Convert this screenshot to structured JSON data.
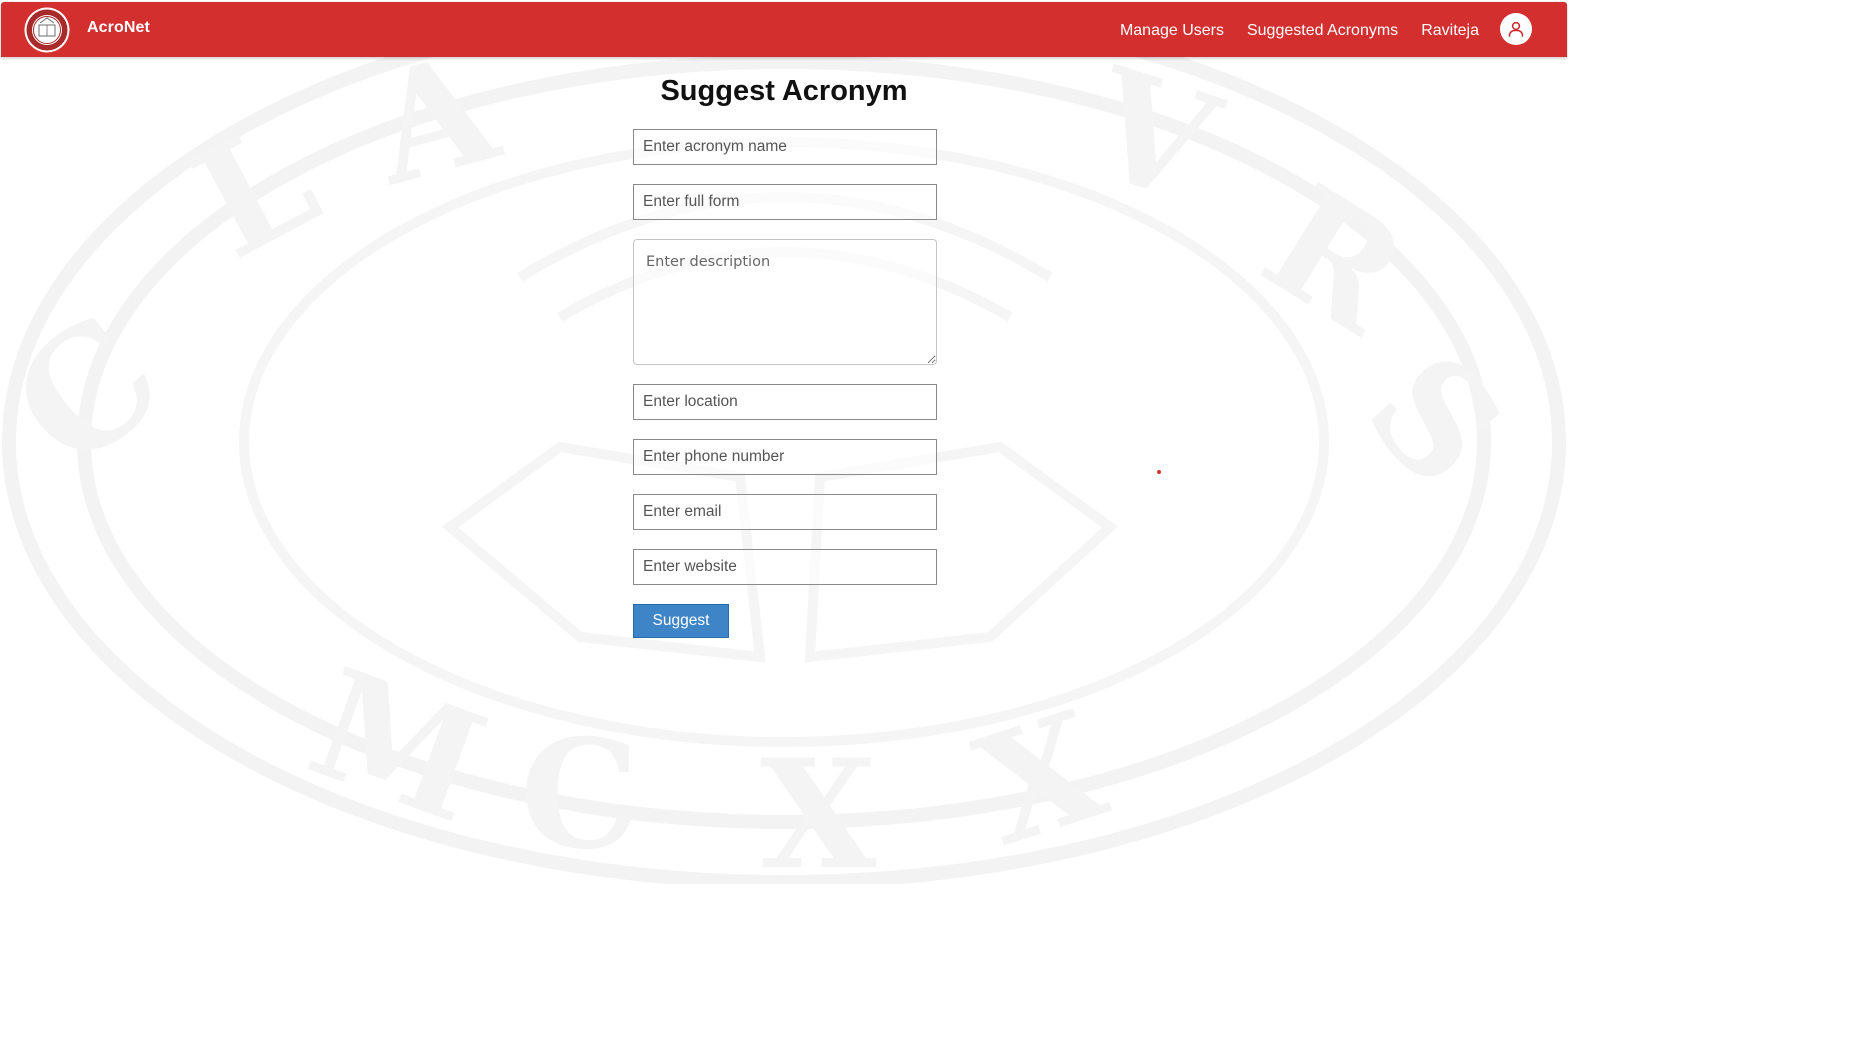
{
  "app": {
    "brand": "AcroNet",
    "brand_color": "#d32f2f",
    "logo_icon": "university-seal-icon"
  },
  "nav": {
    "items": [
      {
        "label": "Manage Users"
      },
      {
        "label": "Suggested Acronyms"
      },
      {
        "label": "Raviteja"
      }
    ],
    "profile_icon": "user-profile-icon"
  },
  "form": {
    "title": "Suggest Acronym",
    "acronym_placeholder": "Enter acronym name",
    "fullform_placeholder": "Enter full form",
    "description_placeholder": "Enter description",
    "location_placeholder": "Enter location",
    "phone_placeholder": "Enter phone number",
    "email_placeholder": "Enter email",
    "website_placeholder": "Enter website",
    "submit_label": "Suggest",
    "submit_color": "#3d85c6"
  }
}
